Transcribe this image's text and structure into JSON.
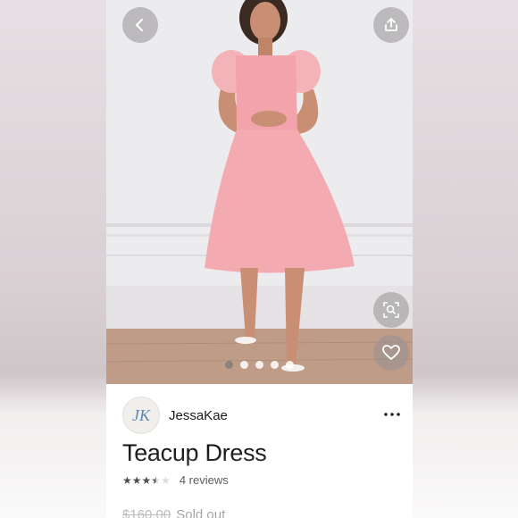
{
  "product": {
    "seller_initials": "JK",
    "seller_name": "JessaKae",
    "title": "Teacup Dress",
    "rating": 3.5,
    "reviews_label": "4 reviews",
    "original_price": "$160.00",
    "status": "Sold out"
  },
  "carousel": {
    "count": 5,
    "active_index": 0
  },
  "icons": {
    "back": "chevron-left-icon",
    "share": "share-icon",
    "visual_search": "visual-search-icon",
    "like": "heart-icon",
    "more": "more-horizontal-icon"
  },
  "colors": {
    "dress": "#f2a3ab",
    "star": "#111111"
  }
}
